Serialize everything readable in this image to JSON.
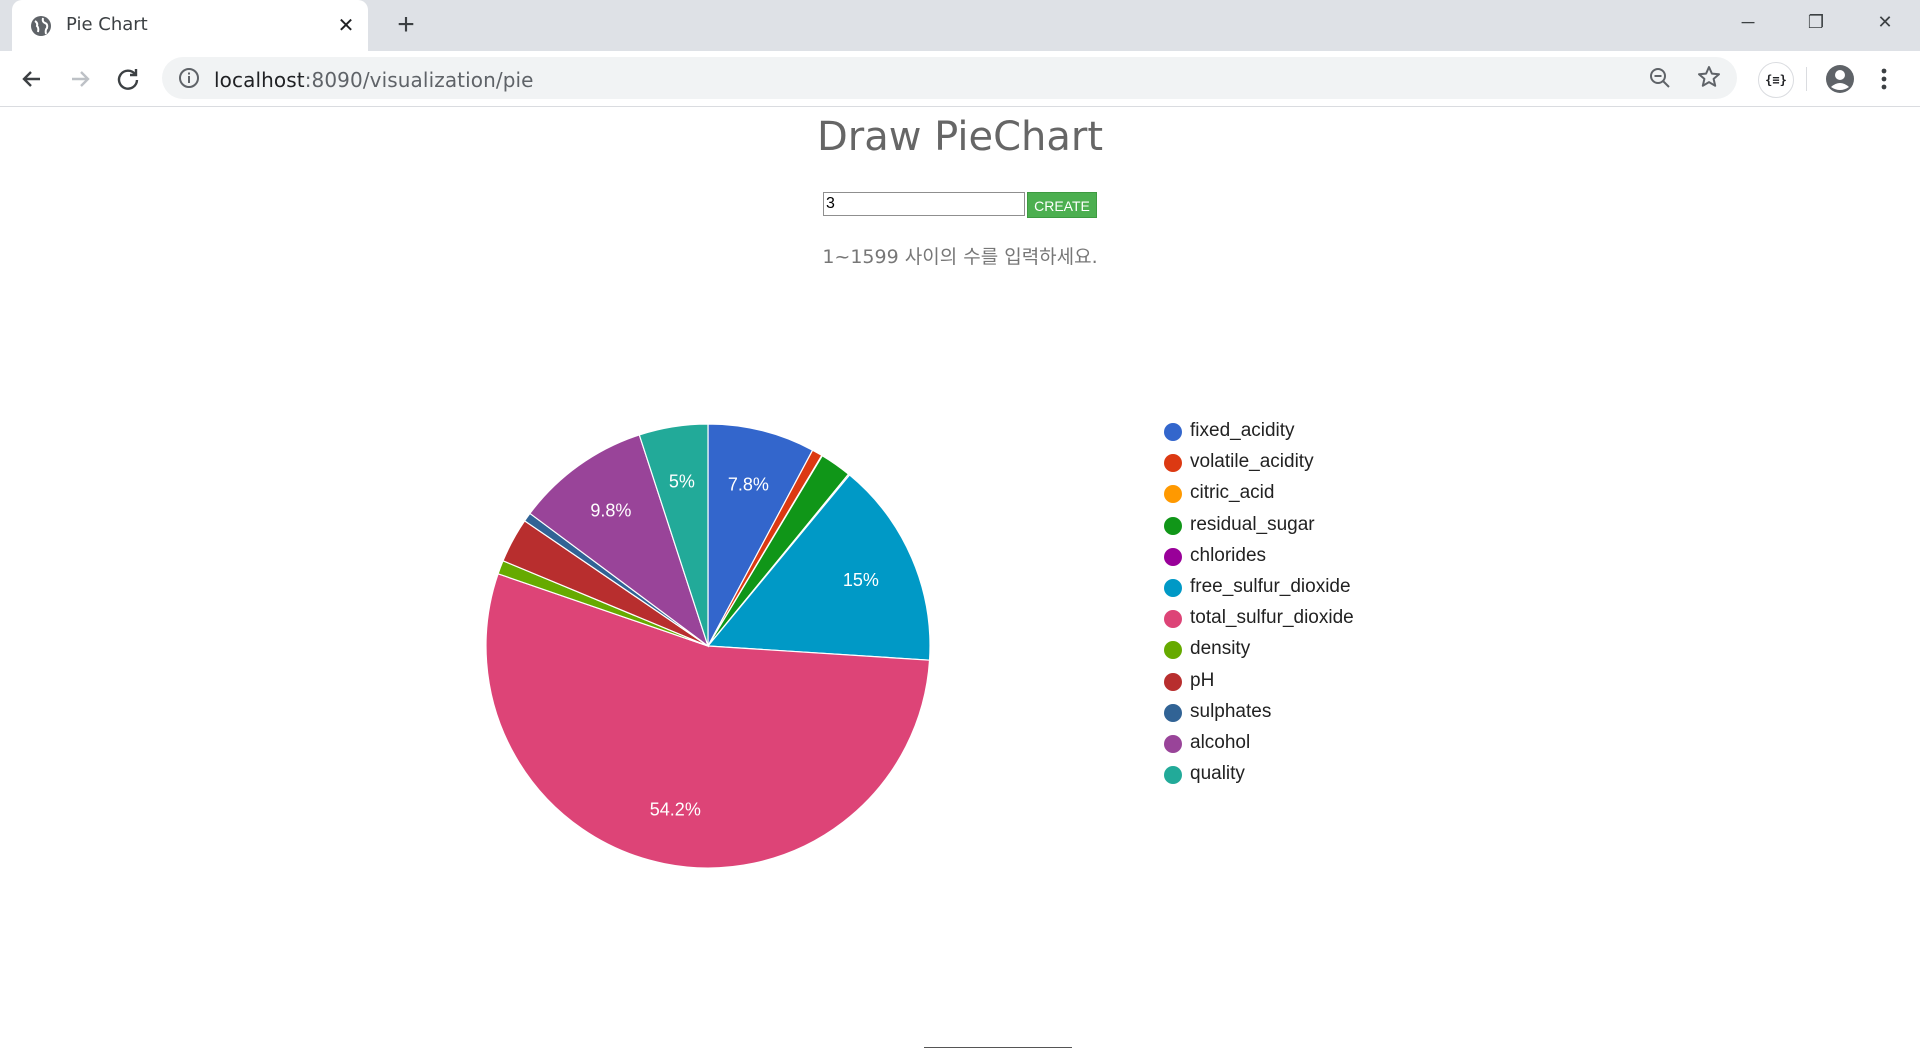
{
  "browser": {
    "tab_title": "Pie Chart",
    "tab_close_glyph": "✕",
    "new_tab_glyph": "+",
    "url_host": "localhost",
    "url_rest": ":8090/visualization/pie",
    "extension_label": "{≡}",
    "window_controls": {
      "minimize": "─",
      "maximize": "❐",
      "close": "✕"
    }
  },
  "page": {
    "title": "Draw PieChart",
    "input_value": "3",
    "create_label": "CREATE",
    "hint": "1~1599 사이의 수를 입력하세요."
  },
  "chart_data": {
    "type": "pie",
    "categories": [
      "fixed_acidity",
      "volatile_acidity",
      "citric_acid",
      "residual_sugar",
      "chlorides",
      "free_sulfur_dioxide",
      "total_sulfur_dioxide",
      "density",
      "pH",
      "sulphates",
      "alcohol",
      "quality"
    ],
    "values": [
      7.8,
      0.76,
      0.04,
      2.3,
      0.092,
      15,
      54.2,
      0.997,
      3.26,
      0.65,
      9.8,
      5
    ],
    "colors": [
      "#3366cc",
      "#dc3912",
      "#ff9900",
      "#109618",
      "#990099",
      "#0099c6",
      "#dd4477",
      "#66aa00",
      "#b82e2e",
      "#316395",
      "#994499",
      "#22aa99"
    ],
    "slice_labels": [
      "7.8%",
      "",
      "",
      "",
      "",
      "15%",
      "54.2%",
      "",
      "",
      "",
      "9.8%",
      "5%"
    ],
    "legend_position": "right"
  }
}
